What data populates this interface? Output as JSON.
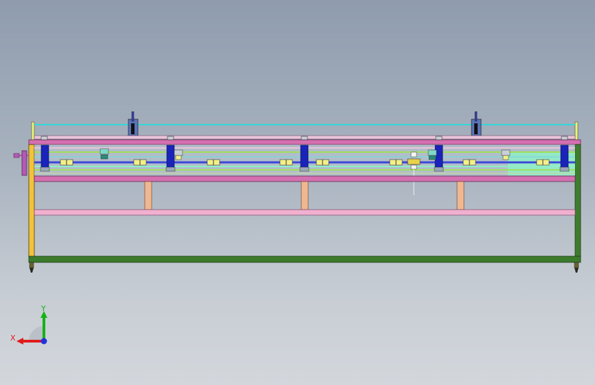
{
  "viewport": {
    "background_top": "#8f9cae",
    "background_bottom": "#d3d7dc"
  },
  "model": {
    "colors": {
      "frame_left_post": "#f2c23a",
      "frame_right_post": "#3f7d2e",
      "frame_base": "#3c7a2c",
      "top_rail": "#d46fb0",
      "rod_cyan": "#2fd9d9",
      "rod_green": "#9fe05a",
      "rod_blue": "#3a47d8",
      "mid_beam": "#d46fb0",
      "lower_beam": "#f1b0cf",
      "support_leg": "#f0b892",
      "clamp_block": "#1a24b8",
      "roller_body": "#f3f08a",
      "handwheel": "#b25ab4",
      "panel_mint": "#8ff0c7"
    },
    "vertical_clamps": 6,
    "rollers": 11,
    "support_legs": 3
  },
  "triad": {
    "x_label": "X",
    "y_label": "Y",
    "x_color": "#e01b1b",
    "y_color": "#14b314",
    "z_color": "#2233dd"
  }
}
